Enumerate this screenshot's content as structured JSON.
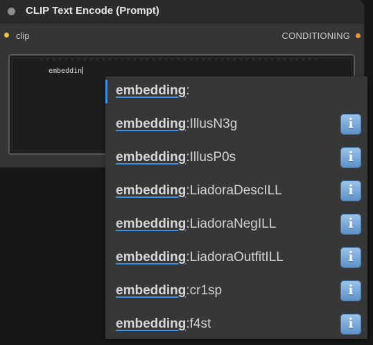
{
  "node": {
    "title": "CLIP Text Encode (Prompt)",
    "input_label": "clip",
    "output_label": "CONDITIONING",
    "text_value": "embeddin"
  },
  "autocomplete": {
    "items": [
      {
        "match": "embedding",
        "rest": ":",
        "info": false,
        "selected": true
      },
      {
        "match": "embedding",
        "rest": ":IllusN3g",
        "info": true,
        "selected": false
      },
      {
        "match": "embedding",
        "rest": ":IllusP0s",
        "info": true,
        "selected": false
      },
      {
        "match": "embedding",
        "rest": ":LiadoraDescILL",
        "info": true,
        "selected": false
      },
      {
        "match": "embedding",
        "rest": ":LiadoraNegILL",
        "info": true,
        "selected": false
      },
      {
        "match": "embedding",
        "rest": ":LiadoraOutfitILL",
        "info": true,
        "selected": false
      },
      {
        "match": "embedding",
        "rest": ":cr1sp",
        "info": true,
        "selected": false
      },
      {
        "match": "embedding",
        "rest": ":f4st",
        "info": true,
        "selected": false
      }
    ],
    "info_glyph": "i"
  },
  "colors": {
    "accent": "#3f8fe0",
    "input_slot": "#f1c232",
    "output_slot": "#f0913a"
  },
  "icons": {
    "info": "info-icon",
    "collapse": "collapse-dot-icon"
  }
}
